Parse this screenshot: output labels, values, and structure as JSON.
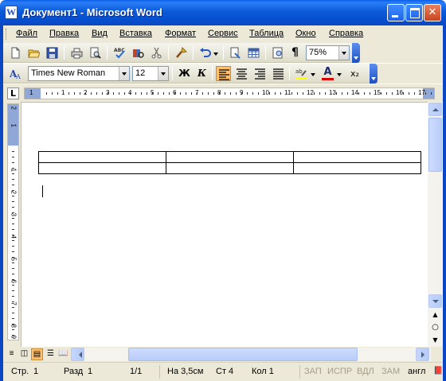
{
  "window": {
    "title": "Документ1 - Microsoft Word"
  },
  "menu": {
    "items": [
      "Файл",
      "Правка",
      "Вид",
      "Вставка",
      "Формат",
      "Сервис",
      "Таблица",
      "Окно",
      "Справка"
    ]
  },
  "toolbar_standard": {
    "zoom_value": "75%",
    "pilcrow_glyph": "¶"
  },
  "toolbar_formatting": {
    "font_name": "Times New Roman",
    "font_size": "12",
    "bold_glyph": "Ж",
    "italic_glyph": "К",
    "subscript_glyph": "x₂",
    "font_color_glyph": "A"
  },
  "ruler": {
    "corner_glyph": "L",
    "h_labels": [
      "1",
      "1",
      "2",
      "3",
      "4",
      "5",
      "6",
      "7",
      "8",
      "9",
      "10",
      "11",
      "12",
      "13",
      "14",
      "15",
      "16",
      "17"
    ],
    "v_labels": [
      "2",
      "1",
      "1",
      "2",
      "3",
      "4",
      "5",
      "6",
      "7",
      "8",
      "9"
    ]
  },
  "document": {
    "table_rows": 2,
    "table_cols": 3
  },
  "status": {
    "page": "Стр.",
    "page_num": "1",
    "section": "Разд",
    "section_num": "1",
    "page_of": "1/1",
    "at": "На 3,5см",
    "line": "Ст 4",
    "col": "Кол 1",
    "rec": "ЗАП",
    "trk": "ИСПР",
    "ext": "ВДЛ",
    "ovr": "ЗАМ",
    "lang": "англ"
  },
  "colors": {
    "title_blue": "#0a5fe6",
    "chrome": "#ece9d8",
    "ruler_margin": "#8fa8d8",
    "active_view": "#ffbf6f"
  }
}
